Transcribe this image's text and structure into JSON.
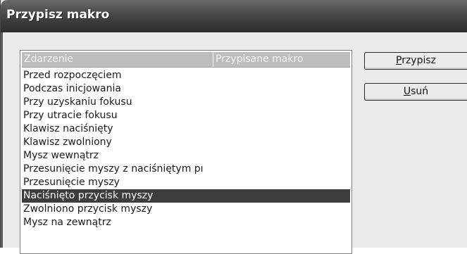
{
  "window": {
    "title": "Przypisz makro"
  },
  "list": {
    "columns": [
      "Zdarzenie",
      "Przypisane makro"
    ],
    "rows": [
      {
        "event": "Przed rozpoczęciem",
        "macro": ""
      },
      {
        "event": "Podczas inicjowania",
        "macro": ""
      },
      {
        "event": "Przy uzyskaniu fokusu",
        "macro": ""
      },
      {
        "event": "Przy utracie fokusu",
        "macro": ""
      },
      {
        "event": "Klawisz naciśnięty",
        "macro": ""
      },
      {
        "event": "Klawisz zwolniony",
        "macro": ""
      },
      {
        "event": "Mysz wewnątrz",
        "macro": ""
      },
      {
        "event": "Przesunięcie myszy z naciśniętym pı",
        "macro": ""
      },
      {
        "event": "Przesunięcie myszy",
        "macro": ""
      },
      {
        "event": "Naciśnięto przycisk myszy",
        "macro": ""
      },
      {
        "event": "Zwolniono przycisk myszy",
        "macro": ""
      },
      {
        "event": "Mysz na zewnątrz",
        "macro": ""
      }
    ],
    "selected_index": 9
  },
  "buttons": {
    "assign": {
      "accel": "P",
      "rest": "rzypisz"
    },
    "remove": {
      "accel": "U",
      "rest": "suń"
    }
  },
  "colors": {
    "titlebar": "#3a3a3a",
    "selection": "#3d3d3d",
    "dialog_bg": "#ebebeb"
  }
}
